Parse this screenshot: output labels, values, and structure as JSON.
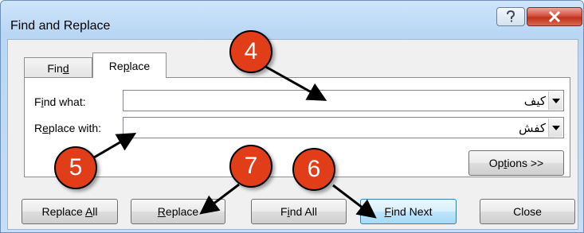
{
  "window": {
    "title": "Find and Replace"
  },
  "titlebar": {
    "help_icon": "question-mark-icon",
    "close_icon": "x-icon"
  },
  "tabs": [
    {
      "label": "Find",
      "active": false
    },
    {
      "label": "Replace",
      "active": true
    }
  ],
  "fields": {
    "find_label": "Find what:",
    "find_value": "کیف",
    "replace_label": "Replace with:",
    "replace_value": "کفش"
  },
  "buttons": {
    "options": "Options >>",
    "replace_all": "Replace All",
    "replace": "Replace",
    "find_all": "Find All",
    "find_next": "Find Next",
    "close": "Close"
  },
  "annotations": [
    "4",
    "5",
    "6",
    "7"
  ],
  "colors": {
    "badge": "#e13d19",
    "titlebar": "#b9d7f4",
    "close_button": "#c0311b",
    "default_button": "#a7d9f5"
  }
}
